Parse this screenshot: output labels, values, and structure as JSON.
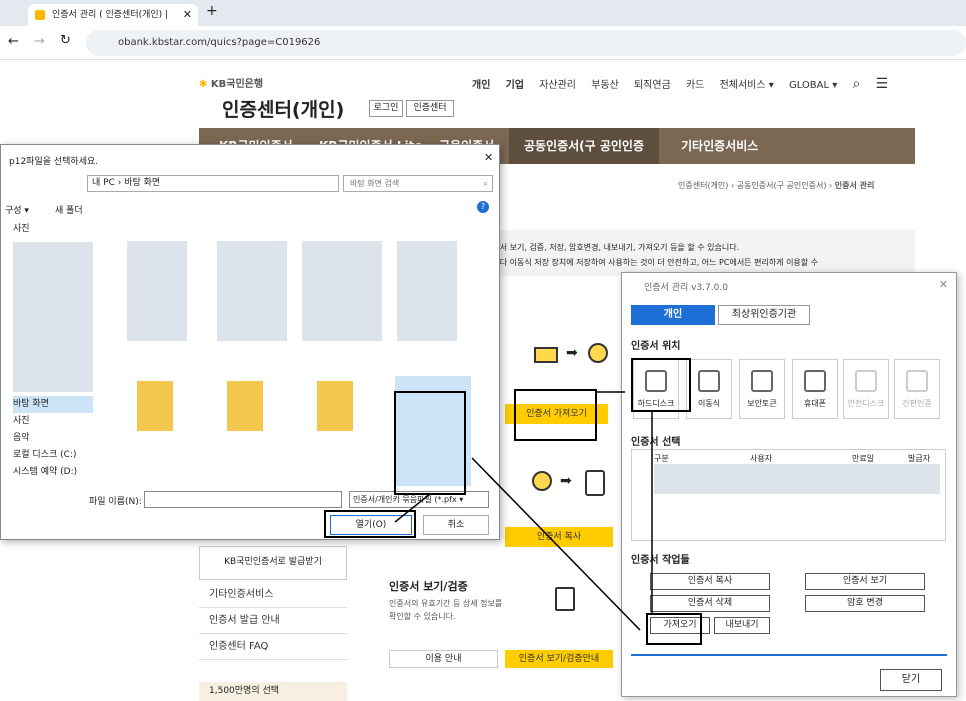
{
  "browser": {
    "tab_title": "인증서 관리 ( 인증센터(개인) |",
    "url": "obank.kbstar.com/quics?page=C019626"
  },
  "site": {
    "logo": "KB국민은행",
    "title": "인증센터(개인)",
    "login": "로그인",
    "cert_center": "인증센터",
    "nav": [
      "개인",
      "기업",
      "자산관리",
      "부동산",
      "퇴직연금",
      "카드",
      "전체서비스 ▾",
      "GLOBAL ▾"
    ],
    "menu": [
      "KB국민인증서",
      "KB국민인증서 Lite",
      "금융인증서",
      "공동인증서(구 공인인증서)",
      "기타인증서비스"
    ],
    "breadcrumb": [
      "인증센터(개인)",
      "공동인증서(구 공인인증서)",
      "인증서 관리"
    ],
    "desc1": "인증서 보기, 검증, 저장, 암호변경, 내보내기, 가져오기 등을 할 수 있습니다.",
    "desc2": "크보다 이동식 저장 장치에 저장하여 사용하는 것이 더 안전하고, 어느 PC에서든 편리하게 이용할 수",
    "import_btn": "인증서 가져오기",
    "copy_btn": "인증서 복사",
    "side_items": [
      "KB국민인증서로 발급받기",
      "기타인증서비스",
      "인증서 발급 안내",
      "인증센터 FAQ"
    ],
    "view_title": "인증서 보기/검증",
    "view_desc1": "인증서의 유효기간 등 상세 정보를",
    "view_desc2": "확인할 수 있습니다.",
    "usage": "이용 안내",
    "view_btn": "인증서 보기/검증안내",
    "bottom": "1,500만명의 선택"
  },
  "file_dialog": {
    "title": "p12파일을 선택하세요.",
    "path": "내 PC › 바탕 화면",
    "search": "바탕 화면 검색",
    "organize": "구성 ▾",
    "new_folder": "새 폴더",
    "tree": [
      "사진",
      "바탕 화면",
      "사진",
      "음악",
      "로컬 디스크 (C:)",
      "시스템 예약 (D:)"
    ],
    "filename_label": "파일 이름(N):",
    "filetype": "인증서/개인키 묶음파일 (*.pfx",
    "open": "열기(O)",
    "cancel": "취소"
  },
  "cert_mgr": {
    "title": "인증서 관리 v3.7.0.0",
    "tabs": [
      "개인",
      "최상위인증기관"
    ],
    "location_label": "인증서 위치",
    "locations": [
      "하드디스크",
      "이동식",
      "보안토큰",
      "휴대폰",
      "안전디스크",
      "간편인증"
    ],
    "select_label": "인증서 선택",
    "columns": [
      "구분",
      "사용자",
      "만료일",
      "발급자"
    ],
    "ops_label": "인증서 작업들",
    "ops": [
      "인증서 복사",
      "인증서 삭제",
      "가져오기",
      "내보내기",
      "인증서 보기",
      "암호 변경"
    ],
    "close": "닫기"
  }
}
